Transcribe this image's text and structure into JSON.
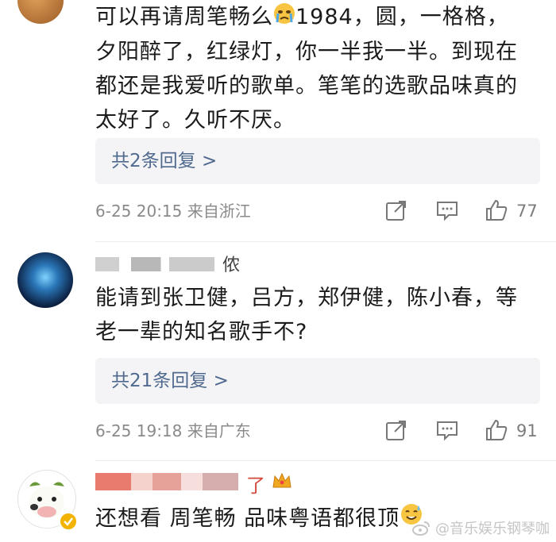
{
  "comments": [
    {
      "text_before_emoji": "可以再请周笔畅么",
      "text_after_emoji": "1984，圆，一格格，",
      "text_lines": [
        "夕阳醉了，红绿灯，你一半我一半。到现在",
        "都还是我爱听的歌单。笔笔的选歌品味真的",
        "太好了。久听不厌。"
      ],
      "emoji": "crying-emoji",
      "replies_label": "共2条回复 >",
      "meta": "6-25 20:15 来自浙江",
      "like_count": "77"
    },
    {
      "username_visible": "侬",
      "text_lines": [
        "能请到张卫健，吕方，郑伊健，陈小春，等",
        "老一辈的知名歌手不?"
      ],
      "replies_label": "共21条回复 >",
      "meta": "6-25 19:18 来自广东",
      "like_count": "91"
    },
    {
      "username_visible": "了",
      "badge": "crown-icon",
      "text": "还想看 周笔畅 品味粤语都很顶",
      "emoji": "sweat-smile-emoji"
    }
  ],
  "watermark": "@音乐娱乐钢琴咖",
  "colors": {
    "link": "#506a8f",
    "meta": "#8a8a8a",
    "reply_bg": "#f4f4f6"
  }
}
